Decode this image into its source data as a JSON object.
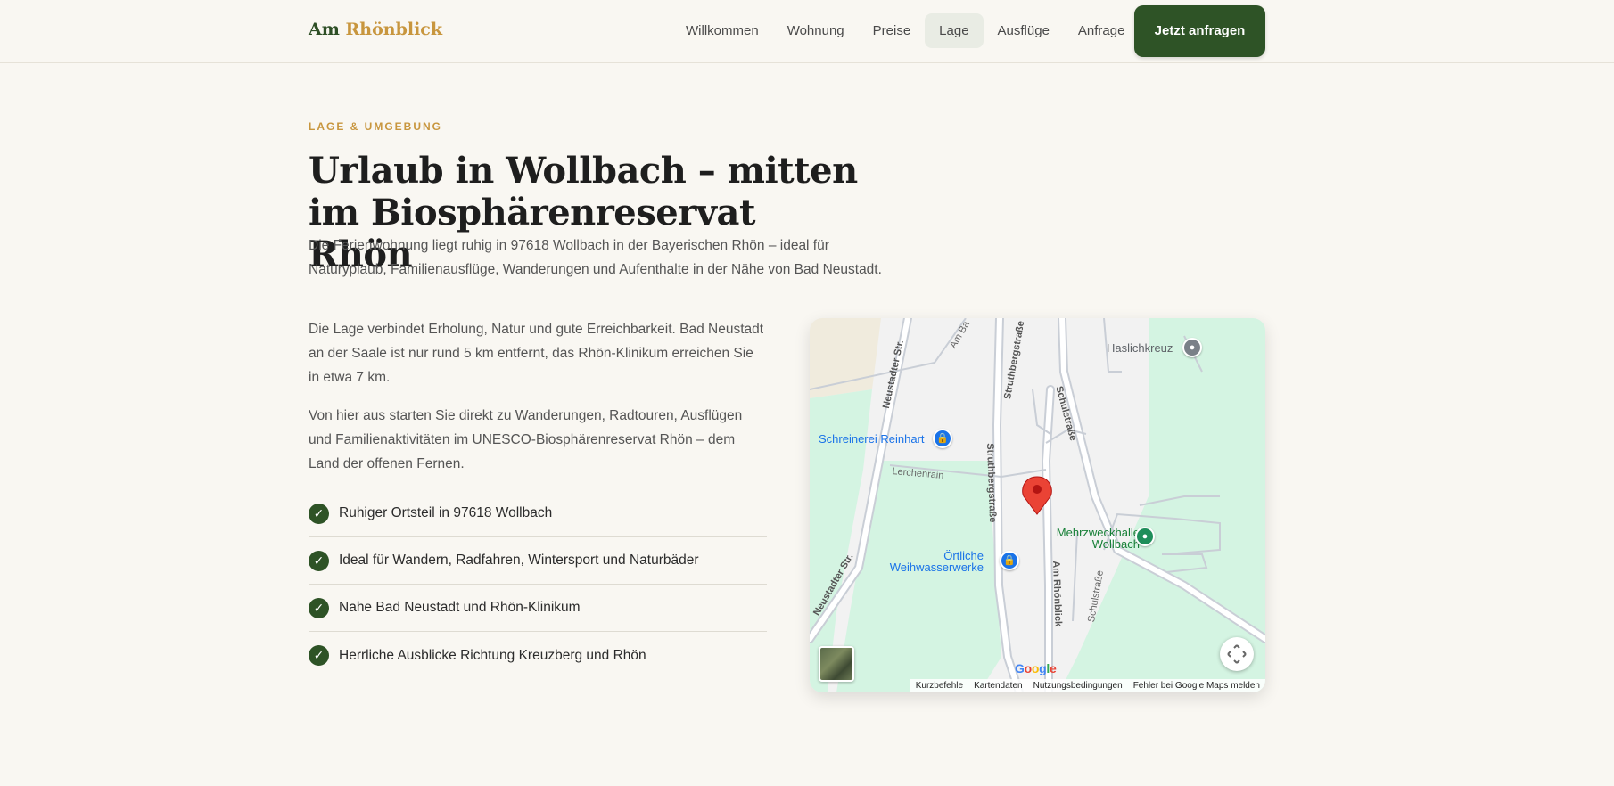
{
  "brand": {
    "part1": "Am",
    "part2": "Rhönblick"
  },
  "nav": {
    "items": [
      {
        "label": "Willkommen"
      },
      {
        "label": "Wohnung"
      },
      {
        "label": "Preise"
      },
      {
        "label": "Lage",
        "active": true
      },
      {
        "label": "Ausflüge"
      },
      {
        "label": "Anfrage"
      }
    ],
    "cta_label": "Jetzt anfragen"
  },
  "colors": {
    "accent_green": "#2e5326",
    "accent_gold": "#c8963e",
    "background": "#f9f7f2"
  },
  "section": {
    "eyebrow": "LAGE & UMGEBUNG",
    "title": "Urlaub in Wollbach – mitten im Biosphärenreservat Rhön",
    "intro": "Die Ferienwohnung liegt ruhig in 97618 Wollbach in der Bayerischen Rhön – ideal für Naturурlaub, Familienausflüge, Wanderungen und Aufenthalte in der Nähe von Bad Neustadt.",
    "paragraphs": [
      "Die Lage verbindet Erholung, Natur und gute Erreichbarkeit. Bad Neustadt an der Saale ist nur rund 5 km entfernt, das Rhön-Klinikum erreichen Sie in etwa 7 km.",
      "Von hier aus starten Sie direkt zu Wanderungen, Radtouren, Ausflügen und Familienaktivitäten im UNESCO-Biosphärenreservat Rhön – dem Land der offenen Fernen."
    ],
    "features": [
      "Ruhiger Ortsteil in 97618 Wollbach",
      "Ideal für Wandern, Radfahren, Wintersport und Naturbäder",
      "Nahe Bad Neustadt und Rhön-Klinikum",
      "Herrliche Ausblicke Richtung Kreuzberg und Rhön"
    ],
    "check_icon": "✓"
  },
  "map": {
    "pois": {
      "schreinerei": "Schreinerei Reinhart",
      "haslichkreuz": "Haslichkreuz",
      "mehrzweckhalle_1": "Mehrzweckhalle",
      "mehrzweckhalle_2": "Wollbach",
      "weihwasser_1": "Örtliche",
      "weihwasser_2": "Weihwasserwerke"
    },
    "streets": {
      "neustadter_1": "Neustadter Str.",
      "neustadter_2": "Neustadter Str.",
      "struthberg_1": "Struthbergstraße",
      "struthberg_2": "Struthbergstraße",
      "schul_1": "Schulstraße",
      "schul_2": "Schulstraße",
      "lerchenrain": "Lerchenrain",
      "am_rhoenblick": "Am Rhönblick",
      "am_ba": "Am Ba"
    },
    "google_logo": "Google",
    "attribution": [
      "Kurzbefehle",
      "Kartendaten",
      "Nutzungsbedingungen",
      "Fehler bei Google Maps melden"
    ]
  }
}
